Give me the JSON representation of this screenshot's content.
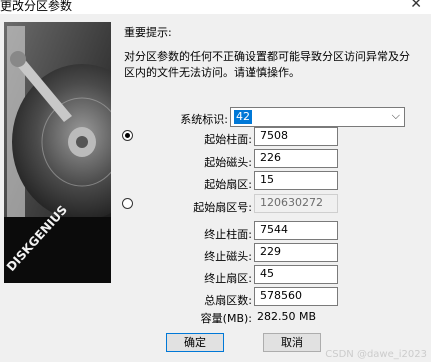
{
  "window": {
    "title": "更改分区参数",
    "close_glyph": "✕"
  },
  "hint": {
    "title": "重要提示:",
    "text": "对分区参数的任何不正确设置都可能导致分区访问异常及分区内的文件无法访问。请谨慎操作。"
  },
  "disk_image": {
    "brand_text": "DISKGENIUS"
  },
  "system_id": {
    "label": "系统标识:",
    "value": "42"
  },
  "chs_mode": {
    "selected": true
  },
  "lba_mode": {
    "selected": false
  },
  "fields": {
    "start_cylinder": {
      "label": "起始柱面:",
      "value": "7508"
    },
    "start_head": {
      "label": "起始磁头:",
      "value": "226"
    },
    "start_sector": {
      "label": "起始扇区:",
      "value": "15"
    },
    "start_lba": {
      "label": "起始扇区号:",
      "value": "120630272"
    },
    "end_cylinder": {
      "label": "终止柱面:",
      "value": "7544"
    },
    "end_head": {
      "label": "终止磁头:",
      "value": "229"
    },
    "end_sector": {
      "label": "终止扇区:",
      "value": "45"
    },
    "total_sectors": {
      "label": "总扇区数:",
      "value": "578560"
    }
  },
  "capacity": {
    "label": "容量(MB):",
    "value": "282.50 MB"
  },
  "buttons": {
    "ok": "确定",
    "cancel": "取消"
  },
  "watermark": "CSDN @dawe_i2023",
  "colors": {
    "selection": "#0078d7",
    "default_button_border": "#0078d7",
    "panel_bg": "#f0f0f0"
  }
}
